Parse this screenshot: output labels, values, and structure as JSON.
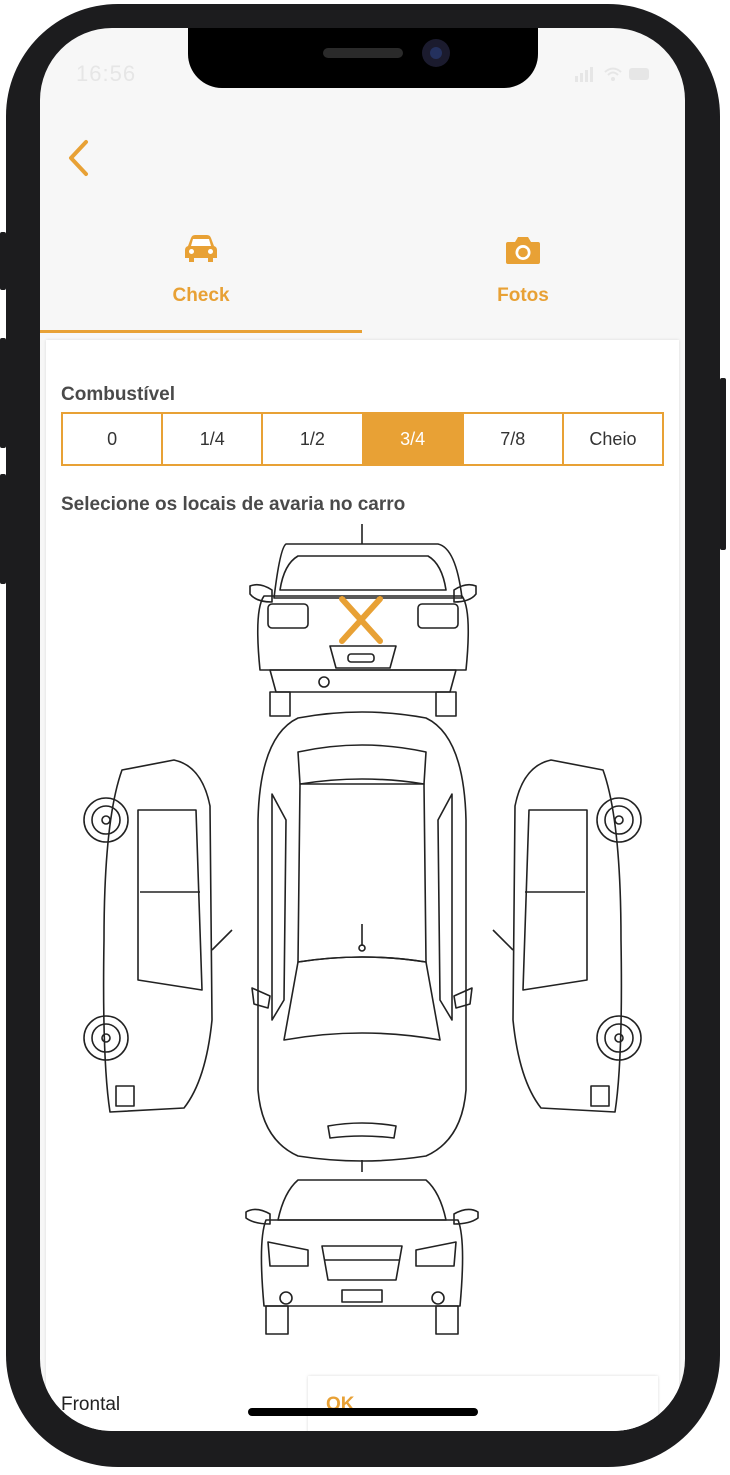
{
  "status_bar": {
    "time": "16:56"
  },
  "colors": {
    "accent": "#e8a135",
    "text_dark": "#4a4a4a"
  },
  "header": {
    "back_icon": "chevron-left-icon"
  },
  "tabs": [
    {
      "label": "Check",
      "icon": "car-icon",
      "active": true
    },
    {
      "label": "Fotos",
      "icon": "camera-icon",
      "active": false
    }
  ],
  "fuel": {
    "title": "Combustível",
    "options": [
      "0",
      "1/4",
      "1/2",
      "3/4",
      "7/8",
      "Cheio"
    ],
    "selected": "3/4"
  },
  "damage": {
    "title": "Selecione os locais de avaria no carro",
    "views": [
      "rear",
      "left",
      "top",
      "right",
      "front"
    ],
    "marked_view": "rear"
  },
  "bottom": {
    "selected_area": "Frontal",
    "ok_label": "OK"
  }
}
